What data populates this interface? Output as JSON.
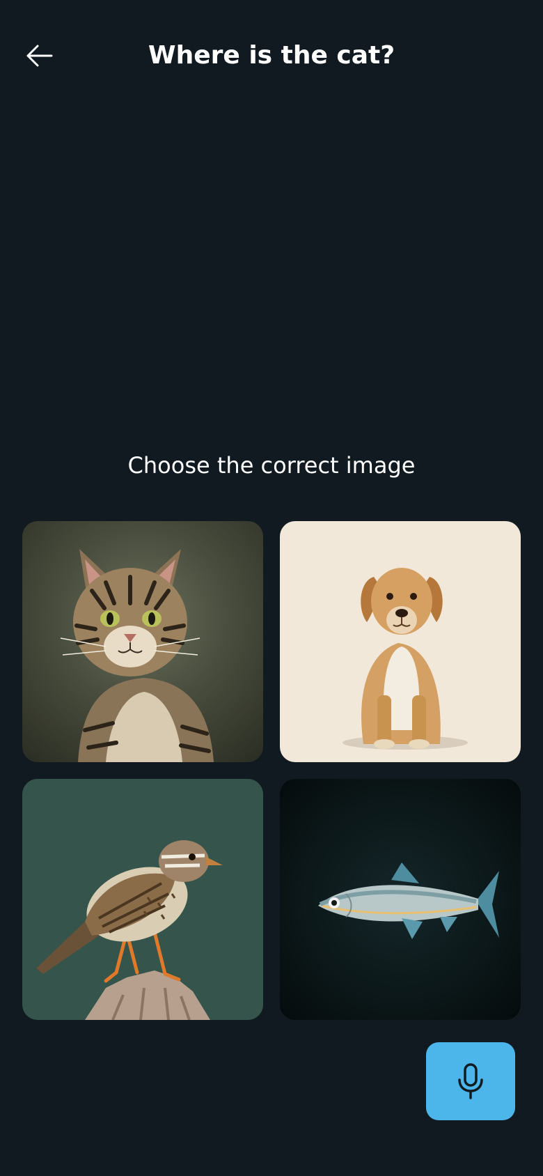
{
  "header": {
    "title": "Where is the cat?",
    "back_icon": "arrow-left-icon"
  },
  "prompt": {
    "instruction": "Choose the correct image"
  },
  "options": [
    {
      "id": "cat",
      "image": "cat-illustration"
    },
    {
      "id": "dog",
      "image": "dog-illustration"
    },
    {
      "id": "bird",
      "image": "bird-illustration"
    },
    {
      "id": "fish",
      "image": "fish-illustration"
    }
  ],
  "mic": {
    "icon": "microphone-icon"
  },
  "colors": {
    "background": "#111a21",
    "mic_button": "#4cb5ea",
    "text": "#ffffff"
  }
}
